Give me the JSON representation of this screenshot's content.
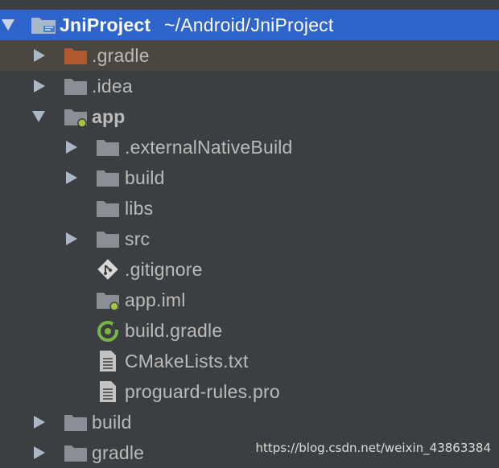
{
  "project": {
    "name": "JniProject",
    "path": "~/Android/JniProject"
  },
  "tree": {
    "gradle_hidden": ".gradle",
    "idea": ".idea",
    "app": "app",
    "externalNativeBuild": ".externalNativeBuild",
    "build_inner": "build",
    "libs": "libs",
    "src": "src",
    "gitignore": ".gitignore",
    "app_iml": "app.iml",
    "build_gradle": "build.gradle",
    "cmakelists": "CMakeLists.txt",
    "proguard": "proguard-rules.pro",
    "build_root": "build",
    "gradle": "gradle"
  },
  "colors": {
    "background": "#3c3f41",
    "selection": "#2f65ca",
    "hover_row": "#4b4740",
    "folder_gray": "#8a8f96",
    "folder_orange": "#b1592c",
    "module_dot": "#a4c639",
    "gradle_green": "#7ab547"
  },
  "watermark": "https://blog.csdn.net/weixin_43863384"
}
